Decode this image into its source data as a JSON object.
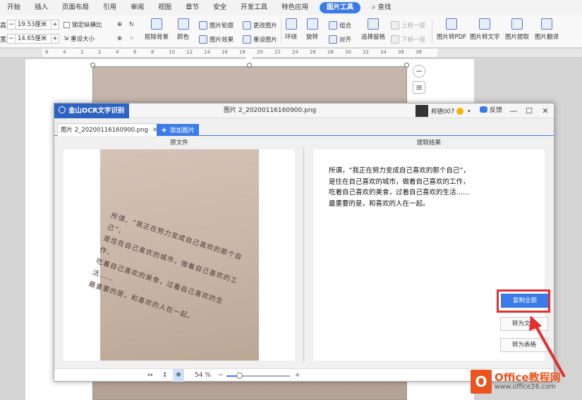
{
  "ribbon": {
    "tabs": [
      "开始",
      "插入",
      "页面布局",
      "引用",
      "审阅",
      "视图",
      "章节",
      "安全",
      "开发工具",
      "特色应用",
      "图片工具"
    ],
    "active_tab": "图片工具",
    "search_label": "查找",
    "height_value": "19.53厘米",
    "width_value": "14.65厘米",
    "lock_ratio_label": "锁定纵横比",
    "reset_size_label": "重设大小",
    "remove_bg_label": "抠除背景",
    "color_label": "颜色",
    "picture_outline_label": "图片轮廓",
    "picture_effect_label": "图片效果",
    "change_picture_label": "更改图片",
    "reset_picture_label": "重设图片",
    "wrap_label": "环绕",
    "rotate_label": "旋转",
    "group_label": "组合",
    "align_label": "对齐",
    "selection_pane_label": "选择窗格",
    "bring_forward_label": "上移一层",
    "send_backward_label": "下移一层",
    "to_pdf_label": "图片转PDF",
    "to_text_label": "图片转文字",
    "extract_label": "图片提取",
    "translate_label": "图片翻译"
  },
  "ruler": {
    "numbers": [
      "6",
      "4",
      "2",
      "2",
      "4",
      "6",
      "8",
      "10",
      "12",
      "14",
      "16",
      "18",
      "20",
      "22",
      "24",
      "26",
      "28",
      "30",
      "32",
      "34",
      "36",
      "38"
    ]
  },
  "ocr": {
    "app_name": "金山OCR文字识别",
    "window_title": "图片 2_20200116160900.png",
    "user_name": "邦德007",
    "feedback_label": "反馈",
    "file_tab_label": "图片 2_20200116160900.png",
    "add_picture_label": "添加图片",
    "source_header": "原文件",
    "result_header": "提取结果",
    "scan_lines": [
      "所谓，“我正在努力变成自己喜欢的那个自己”，",
      "是住在自己喜欢的城市，做着自己喜欢的工作，",
      "吃着自己喜欢的美食，过着自己喜欢的生活……",
      "最重要的是，和喜欢的人在一起。"
    ],
    "result_lines": [
      "所谓，“我正在努力变成自己喜欢的那个自己”，",
      "是住在自己喜欢的城市，做着自己喜欢的工作，",
      "吃着自己喜欢的美食，过着自己喜欢的生活……",
      "最重要的是，和喜欢的人在一起。"
    ],
    "copy_all_label": "复制全部",
    "to_doc_label": "转为文档",
    "to_table_label": "转为表格",
    "zoom": "54 %",
    "zoom_fraction": 0.2
  },
  "watermark": {
    "logo_char": "O",
    "name": "Office教程网",
    "url": "www.office26.com"
  },
  "colors": {
    "accent": "#3b7be8",
    "highlight": "#e03030",
    "watermark": "#e8551e"
  }
}
